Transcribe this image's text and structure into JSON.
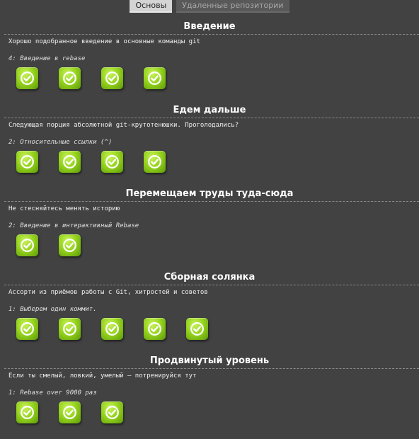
{
  "tabs": [
    {
      "label": "Основы",
      "active": true
    },
    {
      "label": "Удаленные репозитории",
      "active": false
    }
  ],
  "sections": [
    {
      "title": "Введение",
      "description": "Хорошо подобранное введение в основные команды git",
      "current": "4: Введение в rebase",
      "levels": 4
    },
    {
      "title": "Едем дальше",
      "description": "Следующая порция абсолютной git-крутотенюшки. Проголодались?",
      "current": "2: Относительные ссылки (^)",
      "levels": 4
    },
    {
      "title": "Перемещаем труды туда-сюда",
      "description": "Не стесняйтесь менять историю",
      "current": "2: Введение в интерактивный Rebase",
      "levels": 2
    },
    {
      "title": "Сборная солянка",
      "description": "Ассорти из приёмов работы с Git, хитростей и советов",
      "current": "1: Выберем один коммит.",
      "levels": 5
    },
    {
      "title": "Продвинутый уровень",
      "description": "Если ты смелый, ловкий, умелый – потренируйся тут",
      "current": "1: Rebase over 9000 раз",
      "levels": 3
    }
  ],
  "colors": {
    "background": "#424242",
    "level_complete": "#96d41e"
  },
  "icons": {
    "level_state": "check-circle-icon"
  }
}
